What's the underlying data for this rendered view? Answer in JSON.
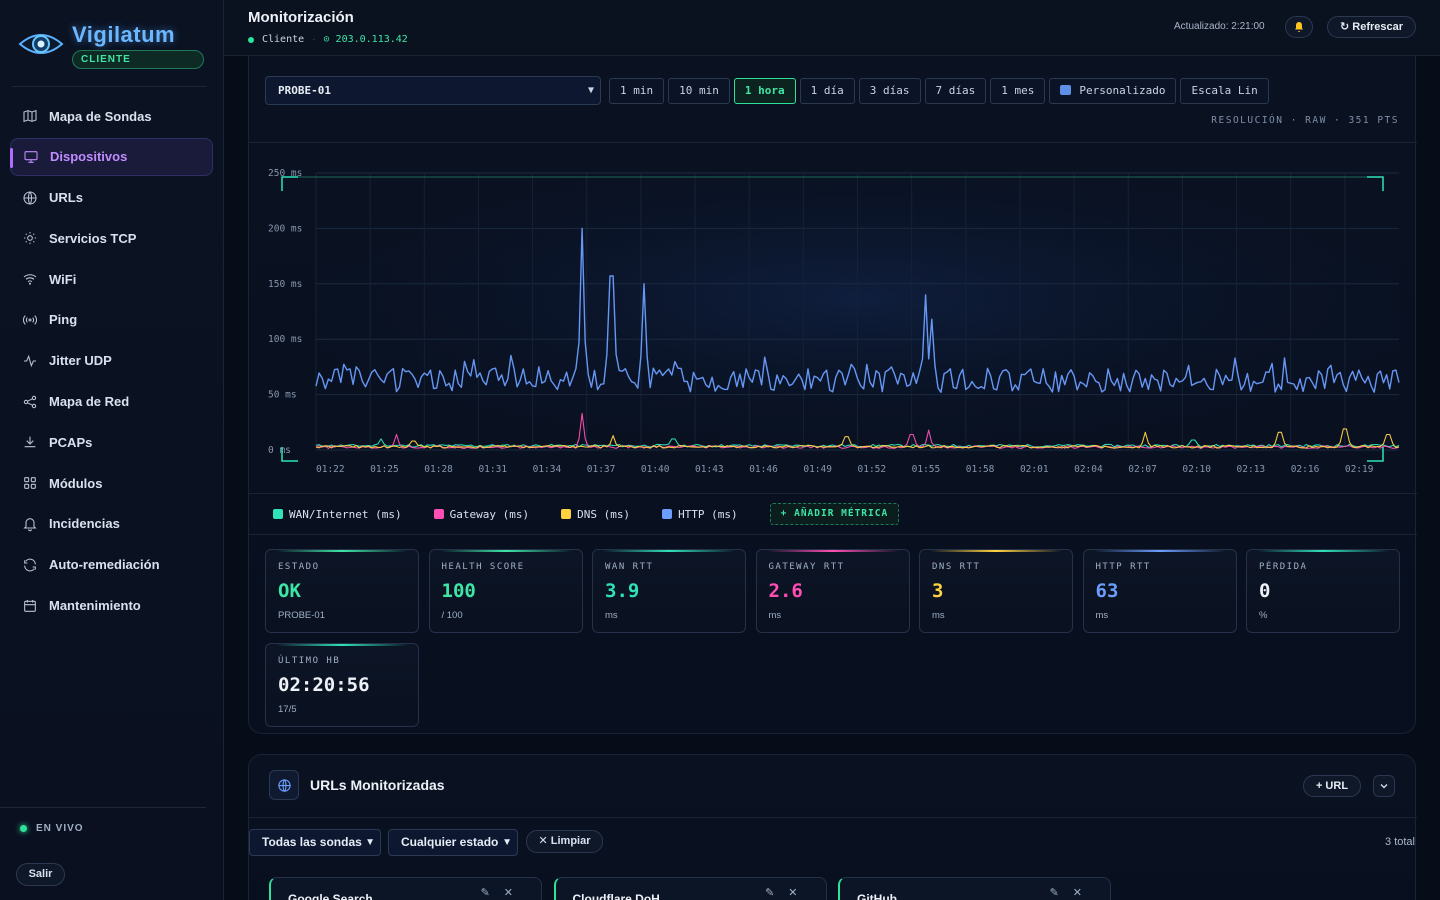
{
  "brand": {
    "name": "Vigilatum",
    "badge": "CLIENTE"
  },
  "sidebar": {
    "items": [
      {
        "label": "Mapa de Sondas",
        "icon": "map-icon"
      },
      {
        "label": "Dispositivos",
        "icon": "monitor-icon",
        "active": true
      },
      {
        "label": "URLs",
        "icon": "globe-icon"
      },
      {
        "label": "Servicios TCP",
        "icon": "sun-icon"
      },
      {
        "label": "WiFi",
        "icon": "wifi-icon"
      },
      {
        "label": "Ping",
        "icon": "signal-icon"
      },
      {
        "label": "Jitter UDP",
        "icon": "pulse-icon"
      },
      {
        "label": "Mapa de Red",
        "icon": "share-icon"
      },
      {
        "label": "PCAPs",
        "icon": "download-icon"
      },
      {
        "label": "Módulos",
        "icon": "grid-icon"
      },
      {
        "label": "Incidencias",
        "icon": "bell-icon"
      },
      {
        "label": "Auto-remediación",
        "icon": "refresh-icon"
      },
      {
        "label": "Mantenimiento",
        "icon": "calendar-icon"
      }
    ],
    "live_label": "EN VIVO",
    "logout_label": "Salir"
  },
  "header": {
    "title": "Monitorización",
    "role": "Cliente",
    "ip": "203.0.113.42",
    "updated": "Actualizado: 2:21:00",
    "refresh_label": "↻ Refrescar"
  },
  "controls": {
    "probe": "PROBE-01",
    "ranges": [
      "1 min",
      "10 min",
      "1 hora",
      "1 día",
      "3 días",
      "7 días",
      "1 mes"
    ],
    "active_range": "1 hora",
    "custom_label": "Personalizado",
    "scale_label": "Escala Lin",
    "resolution": "RESOLUCIÓN · RAW · 351 PTS"
  },
  "chart_data": {
    "type": "line",
    "y_ticks": [
      "250 ms",
      "200 ms",
      "150 ms",
      "100 ms",
      "50 ms",
      "0 ms"
    ],
    "ylim": [
      0,
      250
    ],
    "x_ticks": [
      "01:22",
      "01:25",
      "01:28",
      "01:31",
      "01:34",
      "01:37",
      "01:40",
      "01:43",
      "01:46",
      "01:49",
      "01:52",
      "01:55",
      "01:58",
      "02:01",
      "02:04",
      "02:07",
      "02:10",
      "02:13",
      "02:16",
      "02:19"
    ],
    "series": [
      {
        "name": "WAN/Internet (ms)",
        "color": "#2fe2b8",
        "baseline": 3.9,
        "spikes": [
          [
            0.06,
            10
          ],
          [
            0.33,
            10
          ],
          [
            0.81,
            9
          ]
        ]
      },
      {
        "name": "Gateway (ms)",
        "color": "#ff4fb4",
        "baseline": 2.6,
        "spikes": [
          [
            0.075,
            14
          ],
          [
            0.245,
            33
          ],
          [
            0.55,
            14
          ],
          [
            0.565,
            18
          ]
        ]
      },
      {
        "name": "DNS (ms)",
        "color": "#ffd23f",
        "baseline": 3,
        "spikes": [
          [
            0.09,
            8
          ],
          [
            0.275,
            13
          ],
          [
            0.49,
            12
          ],
          [
            0.765,
            16
          ],
          [
            0.89,
            16
          ],
          [
            0.95,
            19
          ],
          [
            0.99,
            14
          ]
        ]
      },
      {
        "name": "HTTP (ms)",
        "color": "#6b9eff",
        "baseline": 63,
        "spikes": [
          [
            0.245,
            200
          ],
          [
            0.273,
            157
          ],
          [
            0.302,
            150
          ],
          [
            0.563,
            140
          ],
          [
            0.568,
            118
          ]
        ]
      }
    ]
  },
  "legend": {
    "add_metric": "+ AÑADIR MÉTRICA"
  },
  "cards": [
    {
      "label": "ESTADO",
      "value": "OK",
      "unit": "PROBE-01",
      "color": "#3ee6a5"
    },
    {
      "label": "HEALTH SCORE",
      "value": "100",
      "unit": "/ 100",
      "color": "#3ee6a5"
    },
    {
      "label": "WAN RTT",
      "value": "3.9",
      "unit": "ms",
      "color": "#2fe2b8"
    },
    {
      "label": "GATEWAY RTT",
      "value": "2.6",
      "unit": "ms",
      "color": "#ff4fb4"
    },
    {
      "label": "DNS RTT",
      "value": "3",
      "unit": "ms",
      "color": "#ffd23f"
    },
    {
      "label": "HTTP RTT",
      "value": "63",
      "unit": "ms",
      "color": "#6b9eff"
    },
    {
      "label": "PÉRDIDA",
      "value": "0",
      "unit": "%",
      "color": "#eef2f8"
    },
    {
      "label": "ÚLTIMO HB",
      "value": "02:20:56",
      "unit": "17/5",
      "color": "#eef2f8"
    }
  ],
  "urls": {
    "title": "URLs Monitorizadas",
    "add_label": "+ URL",
    "filter_probe": "Todas las sondas",
    "filter_state": "Cualquier estado",
    "clear_label": "✕ Limpiar",
    "total": "3 total",
    "items": [
      "Google Search",
      "Cloudflare DoH",
      "GitHub"
    ]
  }
}
